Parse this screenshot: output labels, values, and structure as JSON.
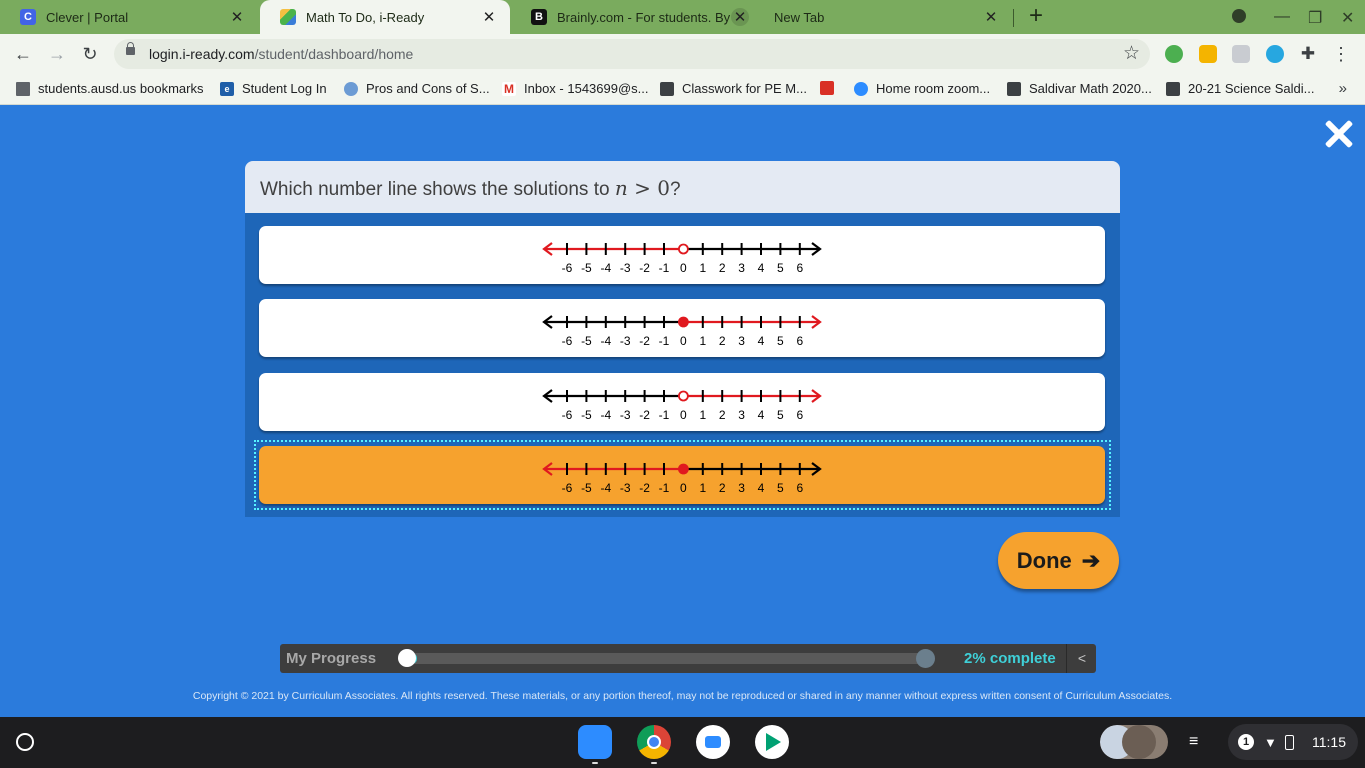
{
  "tabs": [
    {
      "title": "Clever | Portal",
      "favicon": "clever-icon",
      "active": false
    },
    {
      "title": "Math To Do, i-Ready",
      "favicon": "iready-icon",
      "active": true
    },
    {
      "title": "Brainly.com - For students. By stu",
      "favicon": "brainly-icon",
      "active": false
    },
    {
      "title": "New Tab",
      "favicon": "",
      "active": false
    }
  ],
  "address_bar": {
    "host": "login.i-ready.com",
    "path": "/student/dashboard/home"
  },
  "bookmarks": [
    {
      "label": "students.ausd.us bookmarks",
      "icon": "folder-icon"
    },
    {
      "label": "Student Log In",
      "icon": "e-icon"
    },
    {
      "label": "Pros and Cons of S...",
      "icon": "people-icon"
    },
    {
      "label": "Inbox - 1543699@s...",
      "icon": "gmail-icon"
    },
    {
      "label": "Classwork for PE M...",
      "icon": "classroom-icon"
    },
    {
      "label": "",
      "icon": "flag-icon"
    },
    {
      "label": "Home room zoom...",
      "icon": "zoom-icon"
    },
    {
      "label": "Saldivar Math 2020...",
      "icon": "classroom-icon"
    },
    {
      "label": "20-21 Science Saldi...",
      "icon": "classroom-icon"
    }
  ],
  "bookmarks_more": "»",
  "question": {
    "prefix": "Which number line shows the solutions to ",
    "math_var": "n",
    "math_op": " > ",
    "math_num": "0",
    "suffix": "?"
  },
  "number_line": {
    "ticks": [
      "-6",
      "-5",
      "-4",
      "-3",
      "-2",
      "-1",
      "0",
      "1",
      "2",
      "3",
      "4",
      "5",
      "6"
    ]
  },
  "choices": [
    {
      "id": "A",
      "direction": "left",
      "point": 0,
      "closed": false,
      "selected": false
    },
    {
      "id": "B",
      "direction": "right",
      "point": 0,
      "closed": true,
      "selected": false
    },
    {
      "id": "C",
      "direction": "right",
      "point": 0,
      "closed": false,
      "selected": false
    },
    {
      "id": "D",
      "direction": "left",
      "point": 0,
      "closed": true,
      "selected": true
    }
  ],
  "done_button": {
    "label": "Done",
    "arrow": "➔"
  },
  "progress": {
    "label": "My Progress",
    "fraction": 0.02,
    "text": "2% complete",
    "collapse": "<"
  },
  "copyright": "Copyright © 2021 by Curriculum Associates. All rights reserved. These materials, or any portion thereof, may not be reproduced or shared in any manner without express written consent of Curriculum Associates.",
  "shelf": {
    "apps": [
      "zoom-app-icon",
      "chrome-app-icon",
      "meet-app-icon",
      "play-store-icon"
    ],
    "notification_count": "1",
    "time": "11:15"
  },
  "colors": {
    "page_bg": "#2b7bdc",
    "selected_choice": "#f6a22e",
    "solution_red": "#e0191f",
    "progress_accent": "#3fd0d8",
    "tab_strip": "#7aab5e"
  }
}
